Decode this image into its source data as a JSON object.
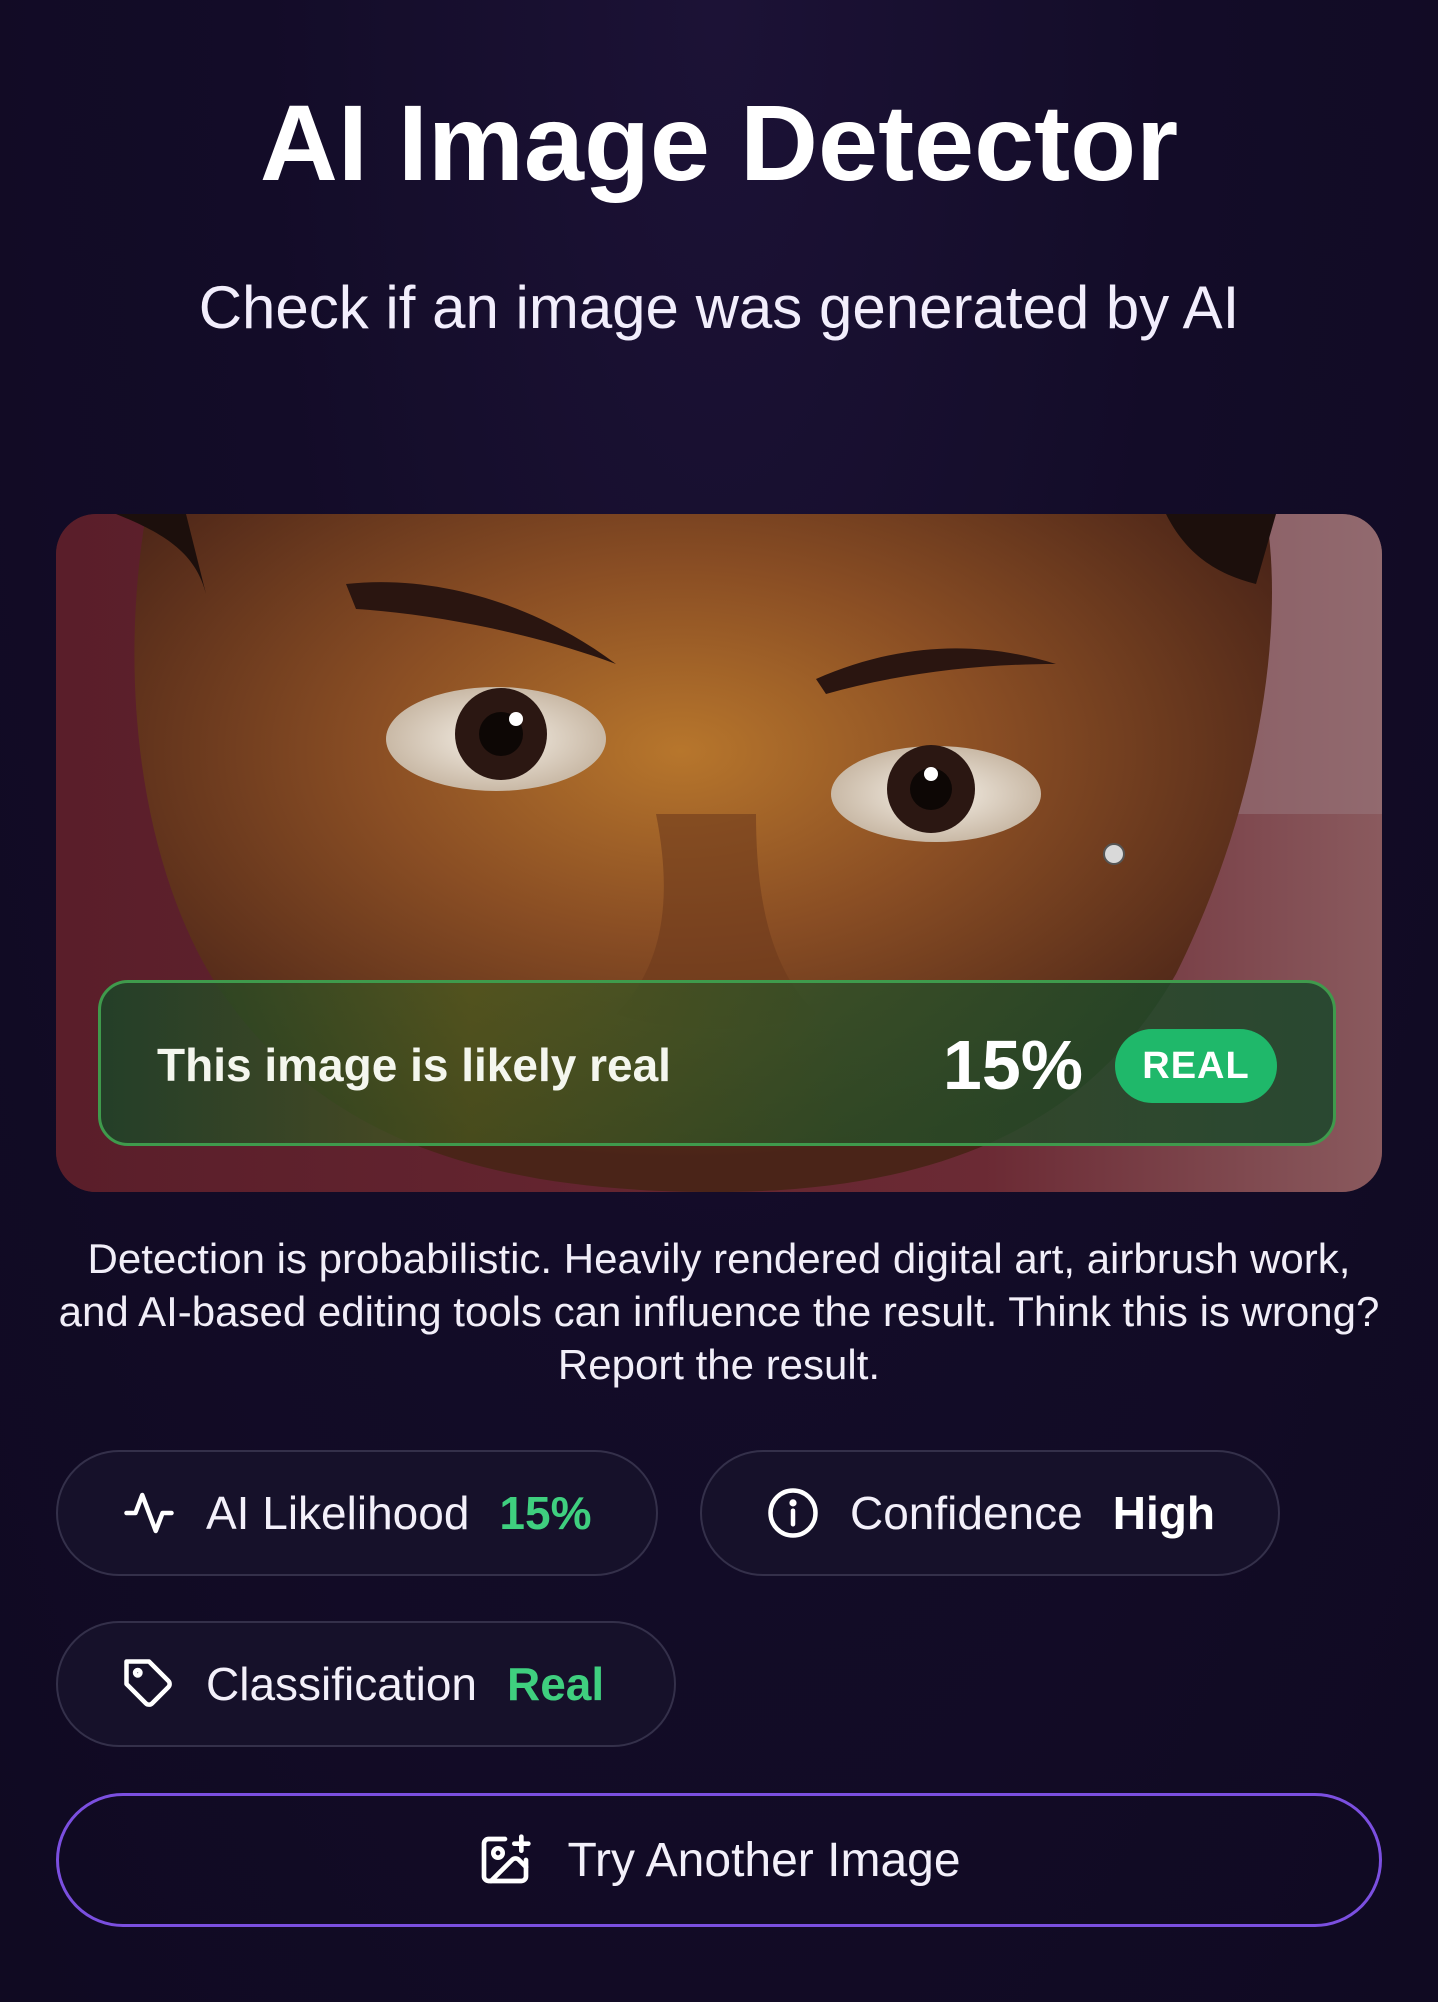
{
  "header": {
    "title": "AI Image Detector",
    "subtitle": "Check if an image was generated by AI"
  },
  "result": {
    "message": "This image is likely real",
    "percent": "15%",
    "badge": "REAL",
    "badge_color": "#1fb86a"
  },
  "disclaimer": "Detection is probabilistic. Heavily rendered digital art, airbrush work, and AI-based editing tools can influence the result. Think this is wrong? Report the result.",
  "stats": {
    "ai_likelihood": {
      "icon": "activity-icon",
      "label": "AI Likelihood",
      "value": "15%",
      "value_color": "#3fcf7f"
    },
    "confidence": {
      "icon": "info-icon",
      "label": "Confidence",
      "value": "High",
      "value_color": "#ffffff"
    },
    "classification": {
      "icon": "tag-icon",
      "label": "Classification",
      "value": "Real",
      "value_color": "#3fcf7f"
    }
  },
  "action": {
    "icon": "image-plus-icon",
    "label": "Try Another Image"
  },
  "colors": {
    "background": "#120b26",
    "accent": "#7b4fe0",
    "success": "#3fcf7f"
  }
}
